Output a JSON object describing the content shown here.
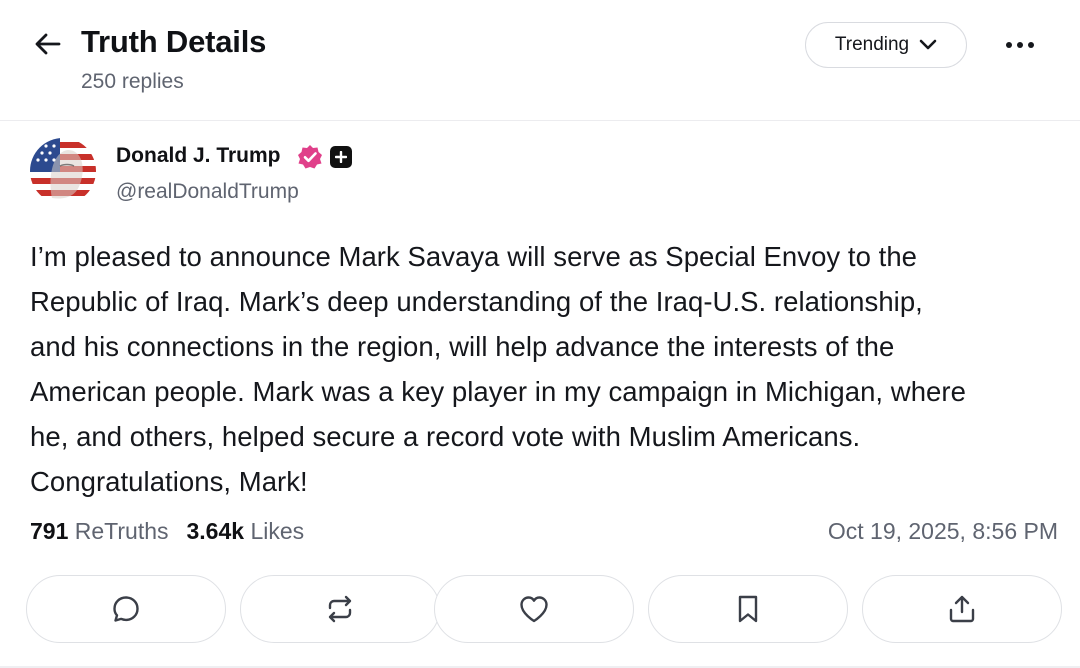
{
  "header": {
    "title": "Truth Details",
    "reply_count": "250 replies",
    "sort_label": "Trending"
  },
  "post": {
    "author_name": "Donald J. Trump",
    "handle": "@realDonaldTrump",
    "body": "I’m pleased to announce Mark Savaya will serve as Special Envoy to the\nRepublic of Iraq. Mark’s deep understanding of the Iraq-U.S. relationship,\nand his connections in the region, will help advance the interests of the\nAmerican people. Mark was a key player in my campaign in Michigan, where\nhe, and others, helped secure a record vote with Muslim Americans.\nCongratulations, Mark!",
    "retruths_count": "791",
    "retruths_label": "ReTruths",
    "likes_count": "3.64k",
    "likes_label": "Likes",
    "timestamp": "Oct 19, 2025, 8:56 PM"
  },
  "actions": [
    {
      "name": "reply",
      "icon": "comment-icon"
    },
    {
      "name": "retruth",
      "icon": "repost-icon"
    },
    {
      "name": "like",
      "icon": "heart-icon"
    },
    {
      "name": "bookmark",
      "icon": "bookmark-icon"
    },
    {
      "name": "share",
      "icon": "share-icon"
    }
  ],
  "colors": {
    "text": "#101114",
    "muted": "#5f6470",
    "verified": "#e0408a",
    "border": "#dfe1e5"
  }
}
